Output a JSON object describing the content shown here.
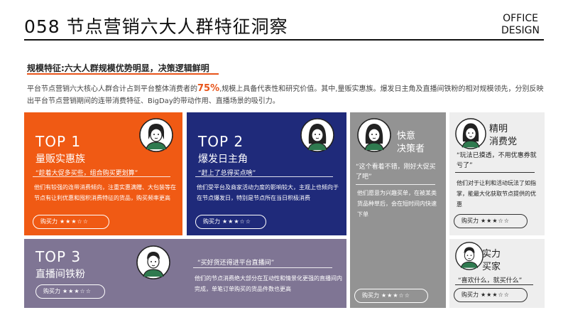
{
  "header": {
    "title": "058 节点营销六大人群特征洞察",
    "brand_line1": "OFFICE",
    "brand_line2": "DESIGN"
  },
  "subhead": "规模特征:六大人群规模优势明显，决策逻辑鲜明",
  "intro": {
    "before": "平台节点营销六大核心人群合计占到平台整体消费者的",
    "highlight": "75%",
    "after": ",规模上具备代表性和研究价值。其中,量贩实惠族。爆发日主角及直播间铁粉的相对规模领先，分别反映出平台节点营销期间的连带消费特征、BigDay的带动作用、直播场景的吸引力。"
  },
  "buy_label": "购买力",
  "cards": {
    "top1": {
      "rank": "TOP 1",
      "title": "量贩实惠族",
      "quote": "“趁着大促多买些，组合购买更划算”",
      "desc": "他们有较强的连带消费倾向，注重实惠满赠、大包装等在节点有让利优惠和囤积消费特征的货品，购买频率更高",
      "stars": "★★★☆☆"
    },
    "top2": {
      "rank": "TOP 2",
      "title": "爆发日主角",
      "quote": "“赶上了总得买点啥”",
      "desc": "他们受平台及商家活动力度的影响较大，主观上也倾向于在节点爆发日，特别是节点所在当日积极消费",
      "stars": "★★★☆☆"
    },
    "top3": {
      "rank": "TOP 3",
      "title": "直播间铁粉",
      "quote": "“买好货还得进平台直播间”",
      "desc": "他们的节点消费绝大部分在互动性和情景化更强的直播间内完成，单笔订单购买的货品件数也更高",
      "stars": "★★★☆☆"
    },
    "quick": {
      "title_line1": "快意",
      "title_line2": "决策者",
      "quote": "“这个看着不错，刚好大促买了吧”",
      "desc": "他们愿意为兴趣买单，在被某类货品种草后，会在短时间内快速下单",
      "stars": "★★★☆☆"
    },
    "smart": {
      "title_line1": "精明",
      "title_line2": "消费党",
      "quote": "“玩法已摸透，不用优惠券就亏了”",
      "desc": "他们对于让利和活动玩法了如指掌，能最大化获取节点提供的优惠",
      "stars": "★★★☆☆"
    },
    "power": {
      "title_line1": "实力",
      "title_line2": "买家",
      "quote": "“喜欢什么，就买什么”",
      "stars": "★★★☆☆"
    }
  },
  "colors": {
    "orange": "#f05a14",
    "navy": "#1f2a7a",
    "gray": "#939393",
    "purple": "#7f7594",
    "light": "#eeeeee"
  }
}
